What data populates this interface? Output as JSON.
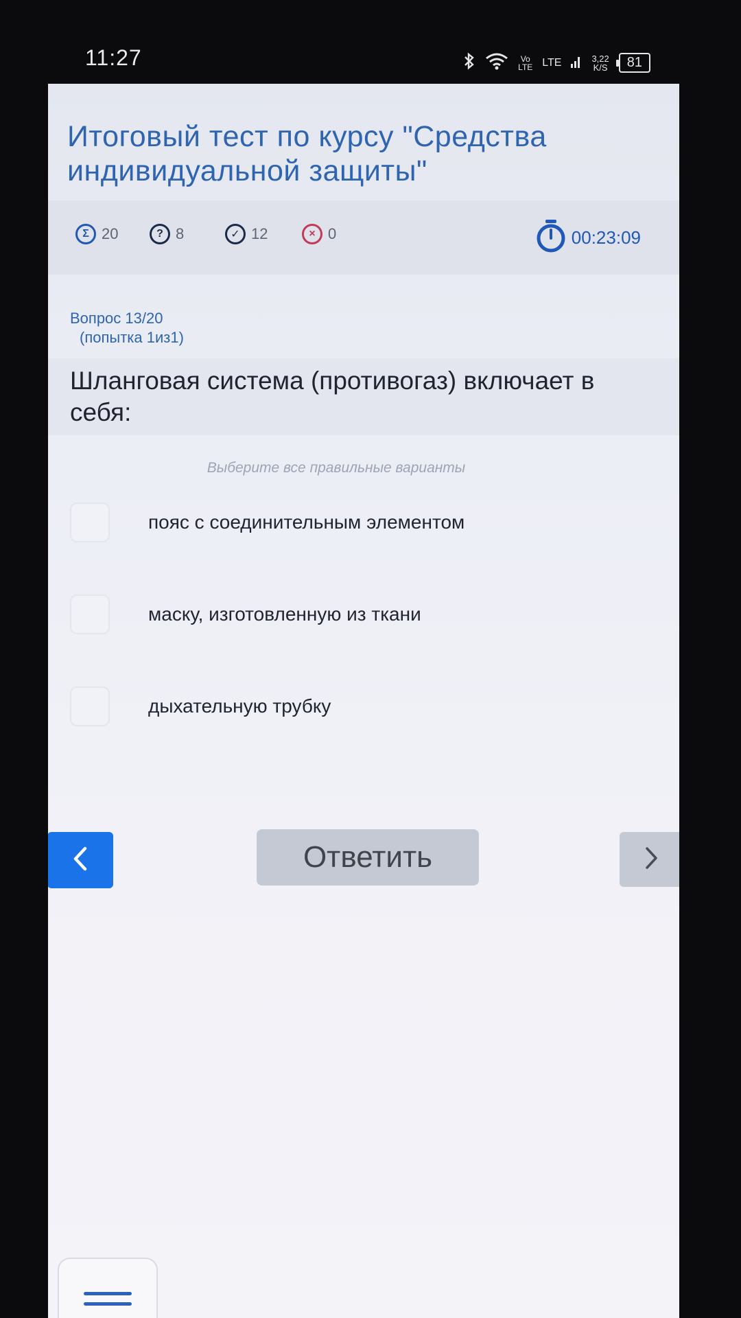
{
  "status_bar": {
    "time": "11:27",
    "network_top": "Vo",
    "network_bottom": "LTE",
    "lte": "LTE",
    "speed_top": "3,22",
    "speed_bottom": "K/S",
    "battery": "81",
    "icons": [
      "bluetooth-icon",
      "wifi-icon",
      "signal-icon",
      "battery-icon"
    ]
  },
  "header": {
    "title": "Итоговый тест по курсу \"Средства индивидуальной защиты\""
  },
  "stats": {
    "total": "20",
    "unanswered": "8",
    "correct": "12",
    "wrong": "0",
    "timer": "00:23:09"
  },
  "question": {
    "number": "Вопрос 13/20",
    "attempt": "(попытка 1из1)",
    "text": "Шланговая система (противогаз) включает в себя:",
    "hint": "Выберите все правильные варианты"
  },
  "options": [
    {
      "label": "пояс с соединительным элементом",
      "checked": false
    },
    {
      "label": "маску, изготовленную из ткани",
      "checked": false
    },
    {
      "label": "дыхательную трубку",
      "checked": false
    }
  ],
  "actions": {
    "answer_label": "Ответить"
  },
  "colors": {
    "accent": "#1a73e8",
    "title": "#2e64b0",
    "button_gray": "#c5c9d4",
    "wrong": "#c23a58"
  }
}
